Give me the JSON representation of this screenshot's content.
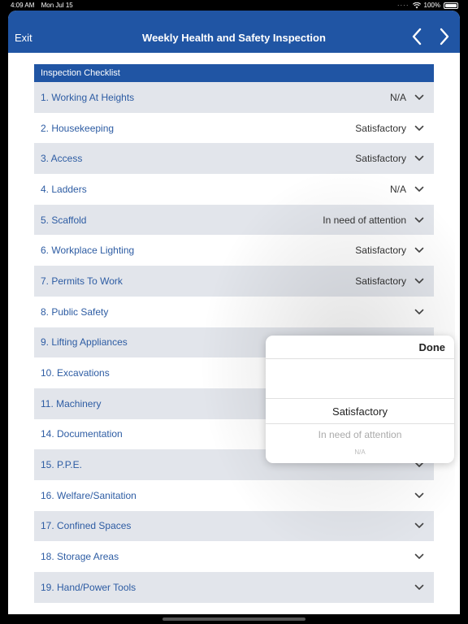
{
  "status": {
    "time": "4:09 AM",
    "date": "Mon Jul 15",
    "battery": "100%"
  },
  "nav": {
    "exit_label": "Exit",
    "title": "Weekly Health and Safety Inspection"
  },
  "checklist": {
    "header": "Inspection Checklist",
    "items": [
      {
        "label": "1. Working At Heights",
        "value": "N/A"
      },
      {
        "label": "2. Housekeeping",
        "value": "Satisfactory"
      },
      {
        "label": "3. Access",
        "value": "Satisfactory"
      },
      {
        "label": "4. Ladders",
        "value": "N/A"
      },
      {
        "label": "5. Scaffold",
        "value": "In need of attention"
      },
      {
        "label": "6. Workplace Lighting",
        "value": "Satisfactory"
      },
      {
        "label": "7. Permits To Work",
        "value": "Satisfactory"
      },
      {
        "label": "8. Public Safety",
        "value": ""
      },
      {
        "label": "9. Lifting Appliances",
        "value": ""
      },
      {
        "label": "10. Excavations",
        "value": ""
      },
      {
        "label": "11. Machinery",
        "value": ""
      },
      {
        "label": "14. Documentation",
        "value": ""
      },
      {
        "label": "15. P.P.E.",
        "value": ""
      },
      {
        "label": "16. Welfare/Sanitation",
        "value": ""
      },
      {
        "label": "17. Confined Spaces",
        "value": ""
      },
      {
        "label": "18. Storage Areas",
        "value": ""
      },
      {
        "label": "19. Hand/Power Tools",
        "value": ""
      }
    ]
  },
  "picker": {
    "done_label": "Done",
    "options": [
      "Satisfactory",
      "In need of attention",
      "N/A"
    ]
  },
  "icons": {
    "chevron": "chevron-down-icon",
    "prev": "chevron-left-icon",
    "next": "chevron-right-icon",
    "wifi": "wifi-icon",
    "battery": "battery-icon"
  },
  "colors": {
    "brand": "#2055a4",
    "row_alt": "#e2e5eb",
    "label": "#2d5ca3"
  }
}
